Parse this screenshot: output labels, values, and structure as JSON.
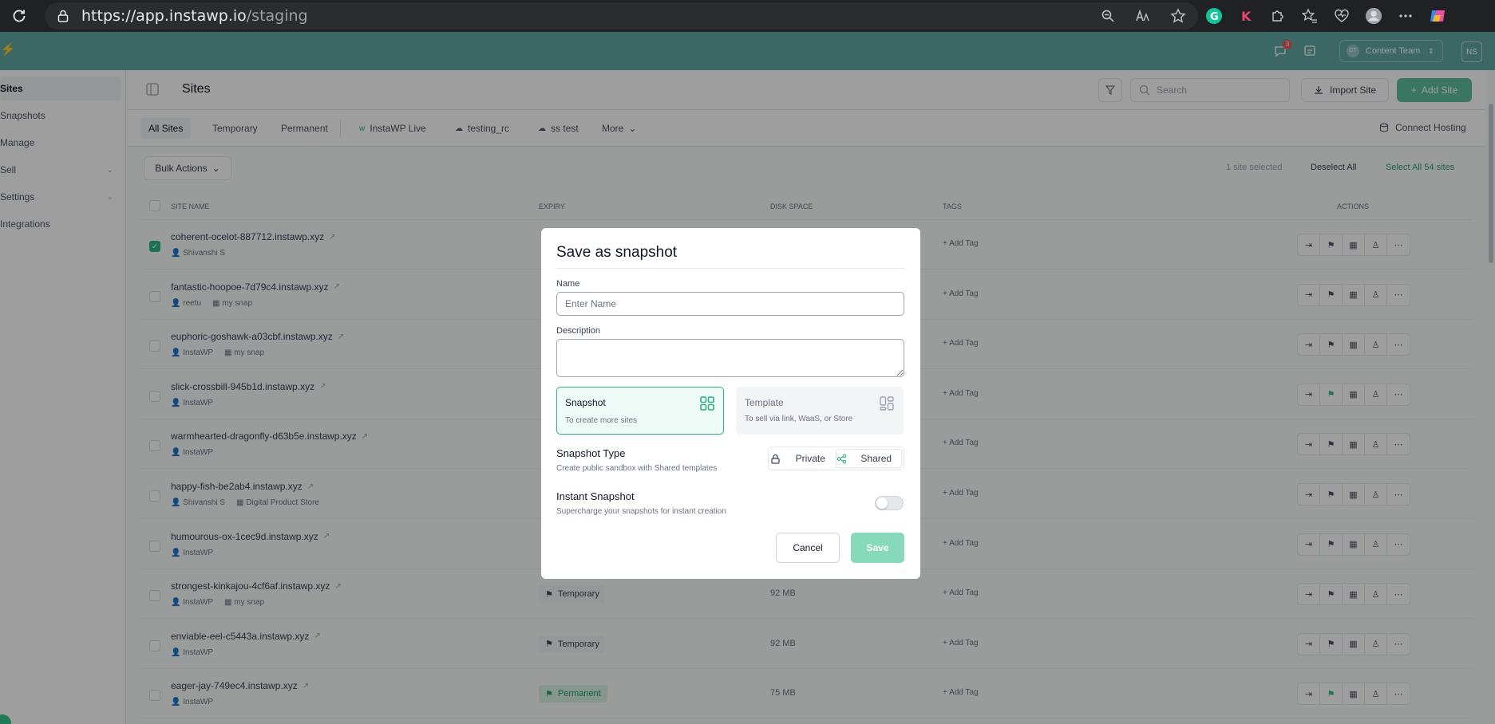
{
  "browser": {
    "url_main": "https://app.instawp.io",
    "url_path": "/staging"
  },
  "topbar": {
    "notification_count": "3",
    "team": "Content Team",
    "team_initials": "CT",
    "user_initials": "NS"
  },
  "sidebar": {
    "items": [
      {
        "label": "Sites"
      },
      {
        "label": "Snapshots"
      },
      {
        "label": "Manage"
      },
      {
        "label": "Sell"
      },
      {
        "label": "Settings"
      },
      {
        "label": "Integrations"
      }
    ]
  },
  "header": {
    "title": "Sites",
    "search_placeholder": "Search",
    "import_label": "Import Site",
    "add_site_label": "Add Site"
  },
  "tabs": {
    "items": [
      {
        "label": "All Sites"
      },
      {
        "label": "Temporary"
      },
      {
        "label": "Permanent"
      },
      {
        "label": "InstaWP Live"
      },
      {
        "label": "testing_rc"
      },
      {
        "label": "ss test"
      },
      {
        "label": "More"
      }
    ],
    "connect_hosting": "Connect Hosting"
  },
  "bulk": {
    "label": "Bulk Actions",
    "selected_text": "1 site selected",
    "deselect_label": "Deselect All",
    "select_all_label": "Select All 54 sites"
  },
  "table": {
    "headers": {
      "name": "SITE NAME",
      "expiry": "EXPIRY",
      "disk": "DISK SPACE",
      "tags": "TAGS",
      "actions": "ACTIONS"
    },
    "add_tag": "+ Add Tag",
    "rows": [
      {
        "name": "coherent-ocelot-887712.instawp.xyz",
        "owner": "Shivanshi S",
        "snapshot": "",
        "expiry": "",
        "disk": ""
      },
      {
        "name": "fantastic-hoopoe-7d79c4.instawp.xyz",
        "owner": "reetu",
        "snapshot": "my snap",
        "expiry": "",
        "disk": ""
      },
      {
        "name": "euphoric-goshawk-a03cbf.instawp.xyz",
        "owner": "InstaWP",
        "snapshot": "my snap",
        "expiry": "",
        "disk": ""
      },
      {
        "name": "slick-crossbill-945b1d.instawp.xyz",
        "owner": "InstaWP",
        "snapshot": "",
        "expiry": "",
        "disk": ""
      },
      {
        "name": "warmhearted-dragonfly-d63b5e.instawp.xyz",
        "owner": "InstaWP",
        "snapshot": "",
        "expiry": "",
        "disk": ""
      },
      {
        "name": "happy-fish-be2ab4.instawp.xyz",
        "owner": "Shivanshi S",
        "snapshot": "Digital Product Store",
        "expiry": "",
        "disk": ""
      },
      {
        "name": "humourous-ox-1cec9d.instawp.xyz",
        "owner": "InstaWP",
        "snapshot": "",
        "expiry": "",
        "disk": ""
      },
      {
        "name": "strongest-kinkajou-4cf6af.instawp.xyz",
        "owner": "InstaWP",
        "snapshot": "my snap",
        "expiry": "Temporary",
        "disk": "92 MB"
      },
      {
        "name": "enviable-eel-c5443a.instawp.xyz",
        "owner": "InstaWP",
        "snapshot": "",
        "expiry": "Temporary",
        "disk": "92 MB"
      },
      {
        "name": "eager-jay-749ec4.instawp.xyz",
        "owner": "InstaWP",
        "snapshot": "",
        "expiry": "Permanent",
        "disk": "75 MB"
      }
    ]
  },
  "modal": {
    "title": "Save as snapshot",
    "name_label": "Name",
    "name_placeholder": "Enter Name",
    "name_value": "",
    "description_label": "Description",
    "description_value": "",
    "snapshot_card": {
      "title": "Snapshot",
      "subtitle": "To create more sites"
    },
    "template_card": {
      "title": "Template",
      "subtitle": "To sell via link, WaaS, or Store"
    },
    "type_title": "Snapshot Type",
    "type_subtitle": "Create public sandbox with Shared templates",
    "private_label": "Private",
    "shared_label": "Shared",
    "instant_title": "Instant Snapshot",
    "instant_subtitle": "Supercharge your snapshots for instant creation",
    "instant_enabled": false,
    "cancel_label": "Cancel",
    "save_label": "Save"
  },
  "colors": {
    "accent": "#2fae84",
    "topbar": "#5fa8a4",
    "save_disabled": "#86d9b9"
  }
}
